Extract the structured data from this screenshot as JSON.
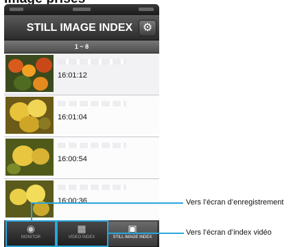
{
  "page_heading": "Image prises",
  "header": {
    "title": "STILL IMAGE INDEX",
    "settings_icon": "gear-icon"
  },
  "range_label": "1 ~ 8",
  "items": [
    {
      "time": "16:01:12"
    },
    {
      "time": "16:01:04"
    },
    {
      "time": "16:00:54"
    },
    {
      "time": "16:00:36"
    }
  ],
  "tabs": [
    {
      "label": "MONITOR",
      "icon": "camera-icon"
    },
    {
      "label": "VIDEO INDEX",
      "icon": "video-index-icon"
    },
    {
      "label": "STILL IMAGE INDEX",
      "icon": "still-camera-icon"
    }
  ],
  "annotations": {
    "recording_screen": "Vers l’écran d’enregistrement",
    "video_index_screen": "Vers l’écran d’index vidéo"
  },
  "colors": {
    "callout": "#29a6dd",
    "titlebar": "#3a3a3a"
  }
}
